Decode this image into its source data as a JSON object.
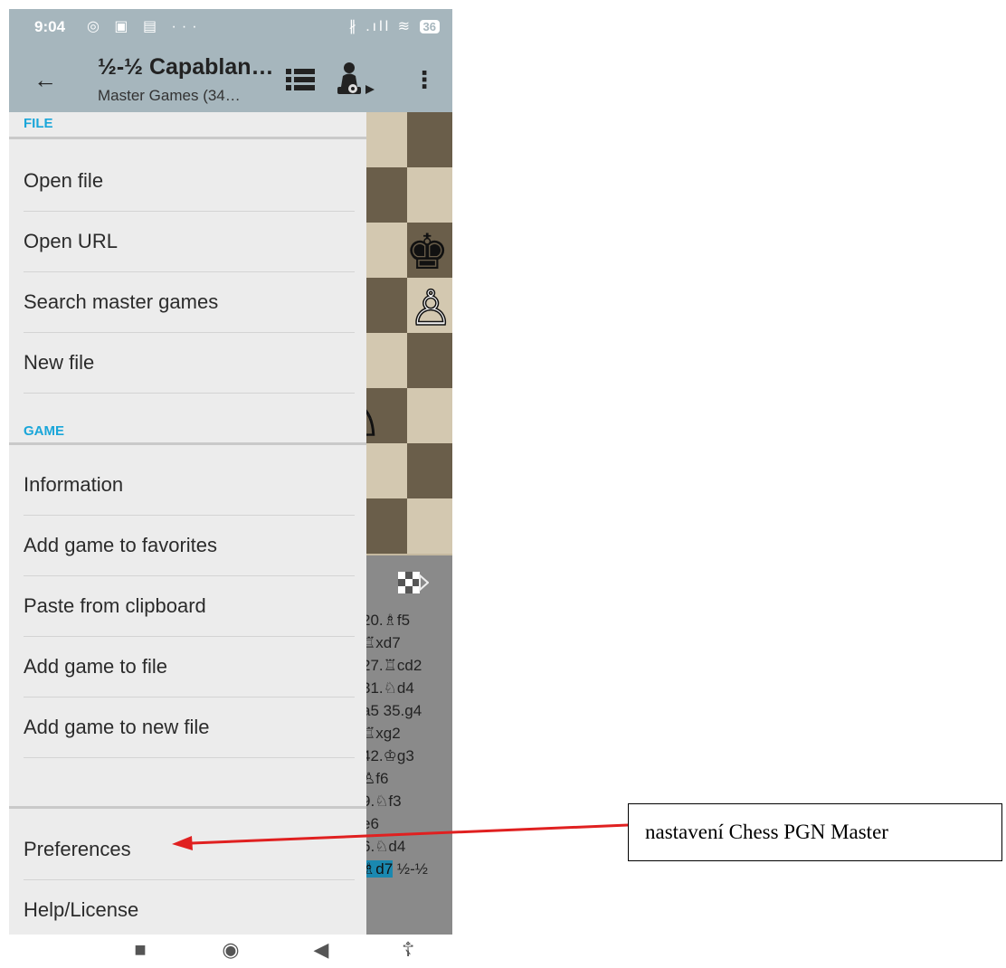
{
  "status_bar": {
    "time": "9:04",
    "left_icons": "◎ ▣ ▤ ···",
    "right_icons": "∦ .ıll ≋",
    "battery": "36"
  },
  "toolbar": {
    "title": "½-½ Capablan…",
    "subtitle": "Master Games (34…",
    "back_icon": "arrow-left-icon",
    "list_icon": "list-icon",
    "engine_icon": "engine-pawn-icon",
    "more_icon": "more-vertical-icon"
  },
  "drawer": {
    "file_section": "FILE",
    "file_items": [
      "Open file",
      "Open URL",
      "Search master games",
      "New file"
    ],
    "game_section": "GAME",
    "game_items": [
      "Information",
      "Add game to favorites",
      "Paste from clipboard",
      "Add game to file",
      "Add game to new file"
    ],
    "bottom_items": [
      "Preferences",
      "Help/License"
    ]
  },
  "board": {
    "pieces": [
      "♚",
      "♙",
      "♘"
    ]
  },
  "moves": {
    "lines": [
      "20.♗f5",
      "♖xd7",
      "27.♖cd2",
      "31.♘d4",
      "a5 35.g4",
      "♖xg2",
      "42.♔g3",
      "♙f6",
      "9.♘f3",
      "e6",
      "6.♘d4"
    ],
    "last_move": "♗d7",
    "result": "½-½"
  },
  "navbar": {
    "recent": "■",
    "home": "◉",
    "back": "◀",
    "accessibility": "☦"
  },
  "annotation": {
    "text": "nastavení Chess PGN Master"
  },
  "colors": {
    "toolbar": "#a6b6bd",
    "accent": "#1aa6d9",
    "arrow": "#e02020"
  }
}
